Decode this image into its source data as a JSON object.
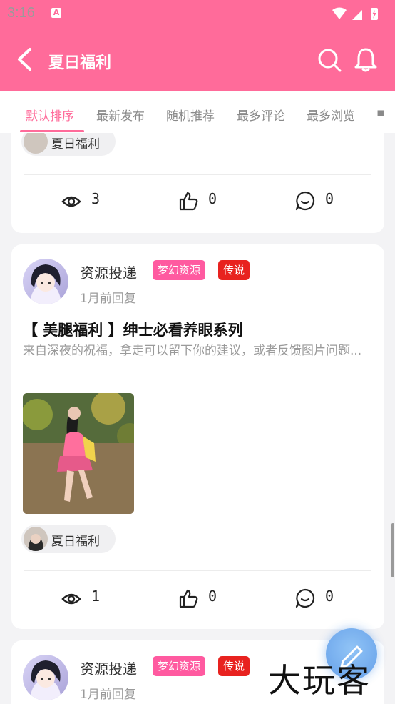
{
  "status_bar": {
    "time": "3:16"
  },
  "header": {
    "title": "夏日福利"
  },
  "tabs": [
    "默认排序",
    "最新发布",
    "随机推荐",
    "最多评论",
    "最多浏览"
  ],
  "cards": [
    {
      "topic": "夏日福利",
      "stats": {
        "views": "3",
        "likes": "0",
        "comments": "0"
      }
    },
    {
      "author": "资源投递",
      "badges": [
        "梦幻资源",
        "传说"
      ],
      "time": "1月前回复",
      "title": "【 美腿福利 】绅士必看养眼系列",
      "excerpt": "来自深夜的祝福，拿走可以留下你的建议，或者反馈图片问题...",
      "topic": "夏日福利",
      "stats": {
        "views": "1",
        "likes": "0",
        "comments": "0"
      }
    },
    {
      "author": "资源投递",
      "badges": [
        "梦幻资源",
        "传说"
      ],
      "time": "1月前回复"
    }
  ],
  "watermark": "大玩客",
  "colors": {
    "primary": "#ff6b9a",
    "badge_pink": "#ff5aa0",
    "badge_red": "#e8221f"
  }
}
